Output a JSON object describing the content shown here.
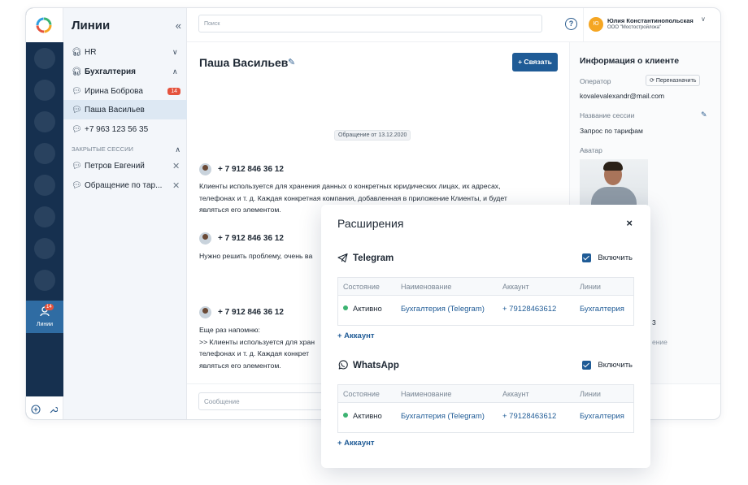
{
  "sidebar": {
    "title": "Линии",
    "rail_active_label": "Линии",
    "rail_active_badge": "14",
    "groups": [
      {
        "label": "HR"
      },
      {
        "label": "Бухгалтерия"
      }
    ],
    "items": [
      {
        "label": "Ирина Боброва",
        "badge": "14"
      },
      {
        "label": "Паша Васильев"
      },
      {
        "label": "+7 963 123 56 35"
      }
    ],
    "closed_header": "ЗАКРЫТЫЕ СЕССИИ",
    "closed_items": [
      {
        "label": "Петров Евгений"
      },
      {
        "label": "Обращение по тар..."
      }
    ]
  },
  "topbar": {
    "search_placeholder": "Поиск",
    "help": "?",
    "user_initials": "Ю",
    "user_name": "Юлия Константинопольская",
    "user_company": "ООО \"Мостостройлока\""
  },
  "chat": {
    "title": "Паша Васильев",
    "connect_label": "+ Связать",
    "date_pill": "Обращение от 13.12.2020",
    "messages": [
      {
        "phone": "+ 7 912 846 36 12",
        "lines": [
          "Клиенты используется для хранения данных о конкретных юридических лицах, их адресах,",
          "телефонах и т. д. Каждая конкретная компания, добавленная в приложение Клиенты, и будет",
          "являться его элементом."
        ]
      },
      {
        "phone": "+ 7 912 846 36 12",
        "lines": [
          "Нужно решить проблему, очень ва"
        ]
      },
      {
        "phone": "+ 7 912 846 36 12",
        "lines": [
          "Еще раз напомню:",
          ">> Клиенты используется для хран",
          "телефонах и т. д. Каждая конкрет",
          "являться его элементом."
        ]
      }
    ],
    "composer_placeholder": "Сообщение"
  },
  "client_info": {
    "title": "Информация о клиенте",
    "operator_label": "Оператор",
    "reassign_label": "Переназначить",
    "operator_value": "kovalevalexandr@mail.com",
    "session_label": "Название сессии",
    "session_value": "Запрос по тарифам",
    "avatar_label": "Аватар",
    "partial_value": "3",
    "partial_label": "ение"
  },
  "modal": {
    "title": "Расширения",
    "close": "×",
    "columns": [
      "Состояние",
      "Наименование",
      "Аккаунт",
      "Линии"
    ],
    "services": [
      {
        "name": "Telegram",
        "toggle_label": "Включить",
        "row": [
          "Активно",
          "Бухгалтерия (Telegram)",
          "+ 79128463612",
          "Бухгалтерия"
        ],
        "add_label": "+  Аккаунт"
      },
      {
        "name": "WhatsApp",
        "toggle_label": "Включить",
        "row": [
          "Активно",
          "Бухгалтерия (Telegram)",
          "+ 79128463612",
          "Бухгалтерия"
        ],
        "add_label": "+  Аккаунт"
      }
    ]
  }
}
